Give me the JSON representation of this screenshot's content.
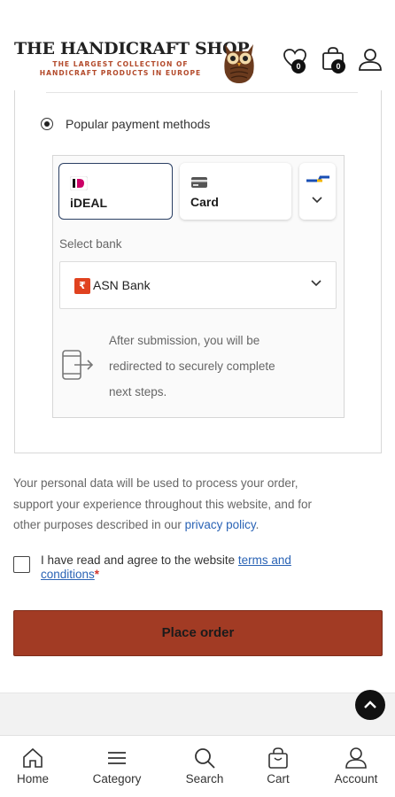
{
  "header": {
    "brand_title": "THE HANDICRAFT SHOP",
    "brand_subtitle_line1": "THE LARGEST COLLECTION OF",
    "brand_subtitle_line2": "HANDICRAFT PRODUCTS IN EUROPE",
    "wishlist_count": "0",
    "cart_count": "0",
    "icons": [
      "heart-icon",
      "shopping-bag-icon",
      "user-icon"
    ],
    "accent_color": "#b34a2b"
  },
  "payment": {
    "option_label": "Popular payment methods",
    "methods": [
      {
        "label": "iDEAL",
        "icon": "ideal-icon",
        "selected": true
      },
      {
        "label": "Card",
        "icon": "card-icon",
        "selected": false
      },
      {
        "label": "",
        "icon": "more-methods-icon",
        "selected": false
      }
    ],
    "select_bank_label": "Select bank",
    "selected_bank": "ASN Bank",
    "bank_logo_glyph": "₹",
    "redirect_line1": "After submission, you will be",
    "redirect_line2": "redirected to securely complete",
    "redirect_line3": "next steps."
  },
  "privacy": {
    "line1": "Your personal data will be used to process your order,",
    "line2": "support your experience throughout this website, and for",
    "line3_prefix": "other purposes described in our ",
    "link": "privacy policy",
    "line3_suffix": "."
  },
  "terms": {
    "prefix": "I have read and agree to the website ",
    "link_part1": "terms and",
    "link_part2": "conditions",
    "required_mark": "*"
  },
  "place_order_label": "Place order",
  "button_color": "#a23b24",
  "bottom_nav": [
    {
      "label": "Home",
      "icon": "home-icon"
    },
    {
      "label": "Category",
      "icon": "menu-icon"
    },
    {
      "label": "Search",
      "icon": "search-icon"
    },
    {
      "label": "Cart",
      "icon": "cart-icon"
    },
    {
      "label": "Account",
      "icon": "account-icon"
    }
  ]
}
